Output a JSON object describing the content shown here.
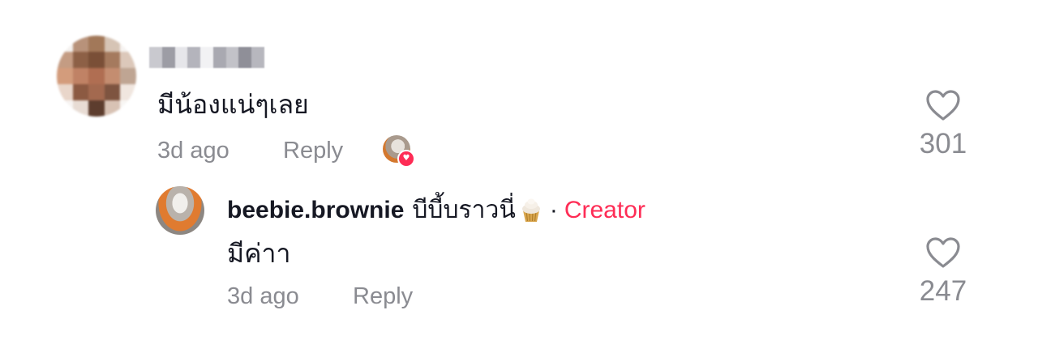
{
  "comment": {
    "text": "มีน้องแน่ๆเลย",
    "time": "3d ago",
    "reply_label": "Reply",
    "like_count": "301",
    "liked_by_creator": true,
    "avatar_pixels": [
      "#f4f1ef",
      "#b8927a",
      "#a27859",
      "#d6c4b5",
      "#f6f3f1",
      "#c49c83",
      "#8d6046",
      "#7a4f37",
      "#a57a5e",
      "#dcc8ba",
      "#d39c7c",
      "#c08265",
      "#b06e52",
      "#c48d70",
      "#bfa593",
      "#e9d6ca",
      "#8c5a42",
      "#a3694f",
      "#7e5440",
      "#f0e6df",
      "#f7f4f2",
      "#e8dcd4",
      "#5d3d2e",
      "#d8c2b4",
      "#f8f6f4"
    ],
    "username_blur_pixels": [
      "#c9c9cf",
      "#9d9da5",
      "#e6e6ea",
      "#b4b4bc",
      "#f2f2f4",
      "#a9a9b1",
      "#c2c2c8",
      "#8f8f98",
      "#b7b7be"
    ]
  },
  "reply": {
    "username": "beebie.brownie",
    "nickname": "บีบี้บราวนี่",
    "separator": "·",
    "badge": "Creator",
    "text": "มีค่าา",
    "time": "3d ago",
    "reply_label": "Reply",
    "like_count": "247"
  },
  "colors": {
    "accent": "#fe2c55",
    "muted": "#8a8b91",
    "text": "#161823"
  },
  "icons": {
    "like": "heart-outline-icon",
    "creator_liked": "heart-badge-icon",
    "emoji": "cupcake-icon"
  }
}
